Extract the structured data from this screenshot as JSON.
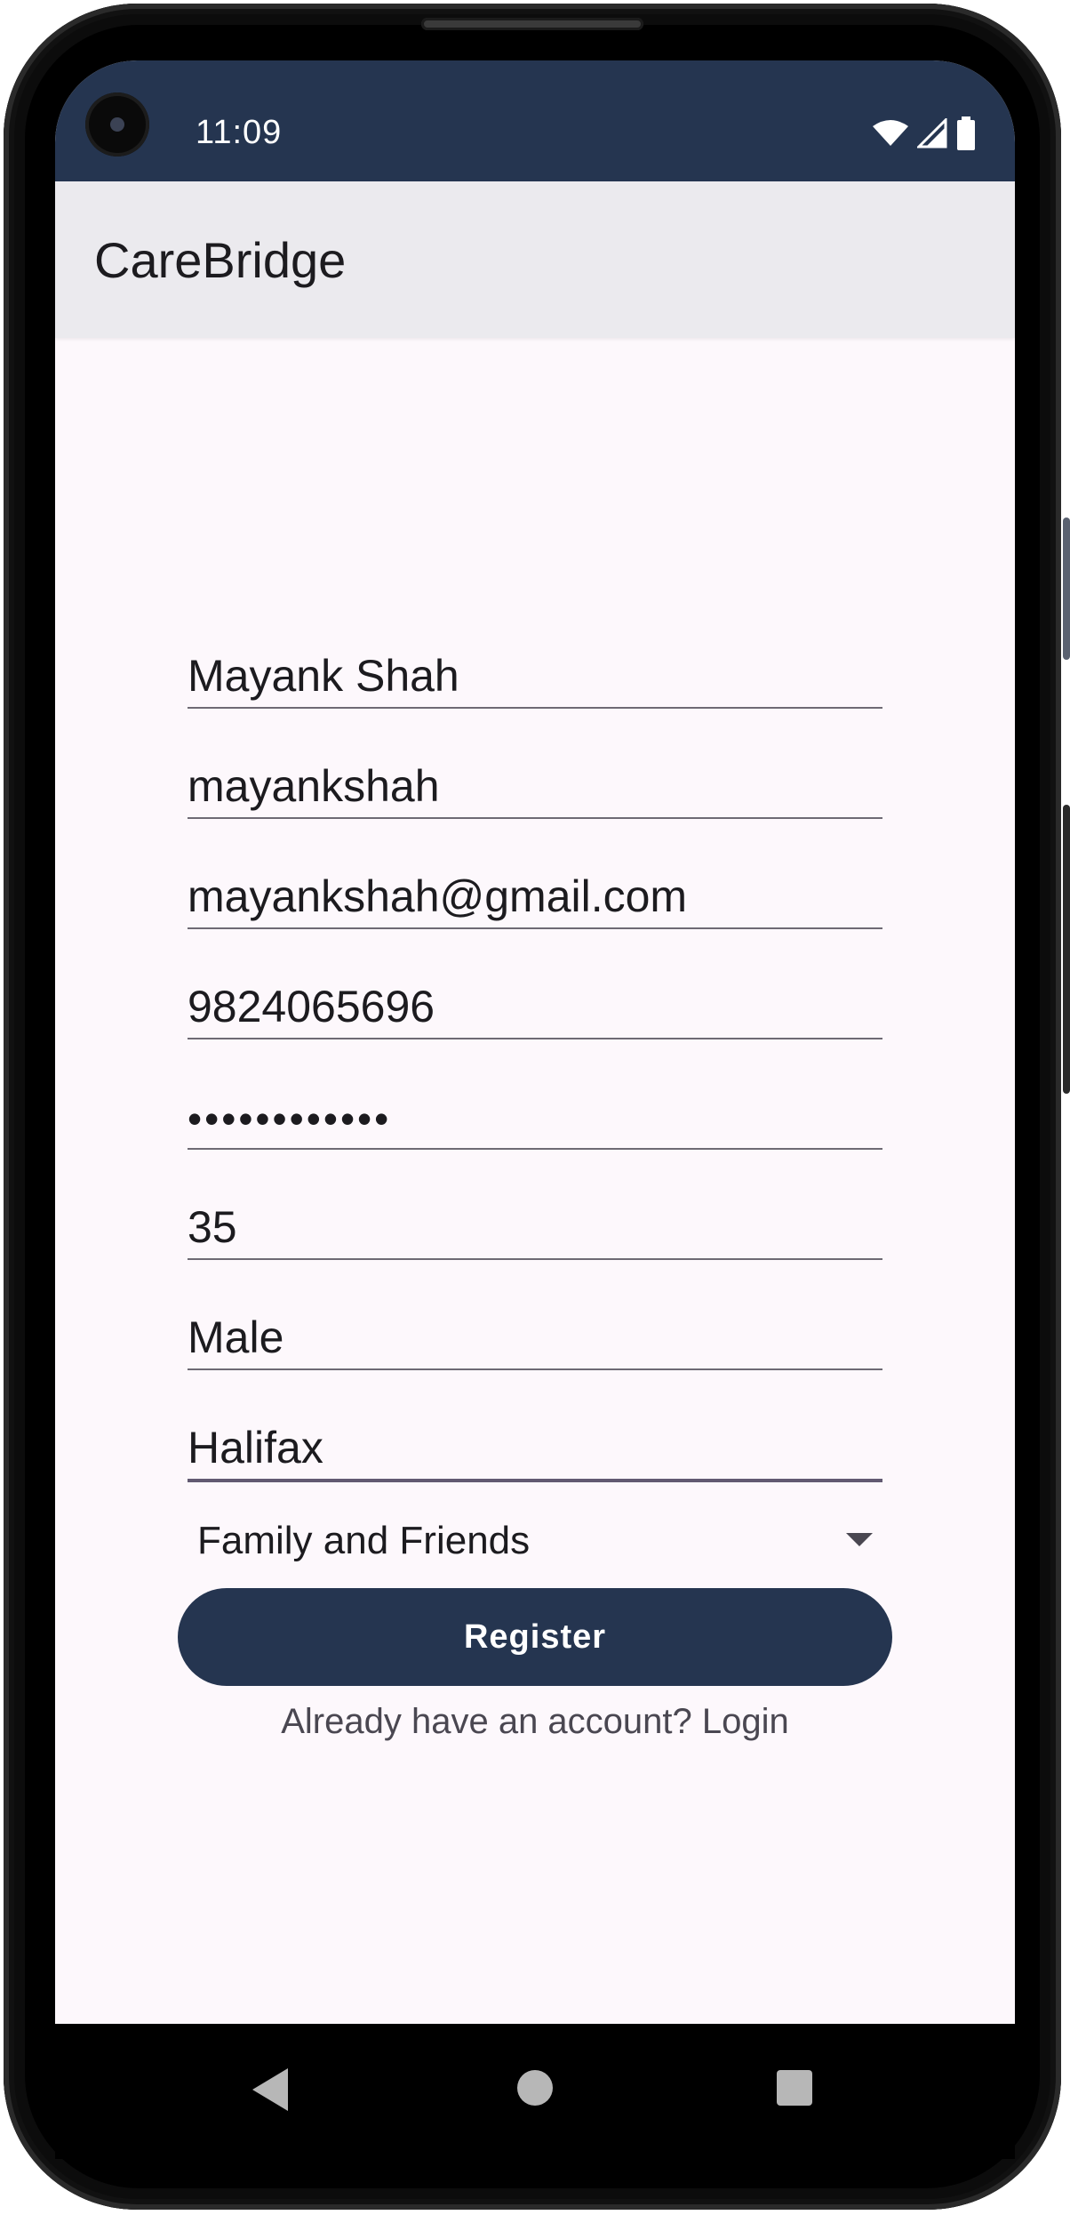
{
  "status_bar": {
    "time": "11:09",
    "icons": [
      "wifi-icon",
      "signal-icon",
      "battery-icon"
    ]
  },
  "app_bar": {
    "title": "CareBridge"
  },
  "form": {
    "full_name": "Mayank Shah",
    "username": "mayankshah",
    "email": "mayankshah@gmail.com",
    "phone": "9824065696",
    "password": "••••••••••••",
    "age": "35",
    "gender": "Male",
    "city": "Halifax",
    "relationship_selected": "Family and Friends",
    "register_label": "Register",
    "login_link": "Already have an account? Login"
  },
  "nav_bar": {
    "buttons": [
      "back-icon",
      "home-icon",
      "recents-icon"
    ]
  },
  "colors": {
    "primary": "#253550",
    "background": "#fdf8fc",
    "appbar": "#ebeaee"
  }
}
